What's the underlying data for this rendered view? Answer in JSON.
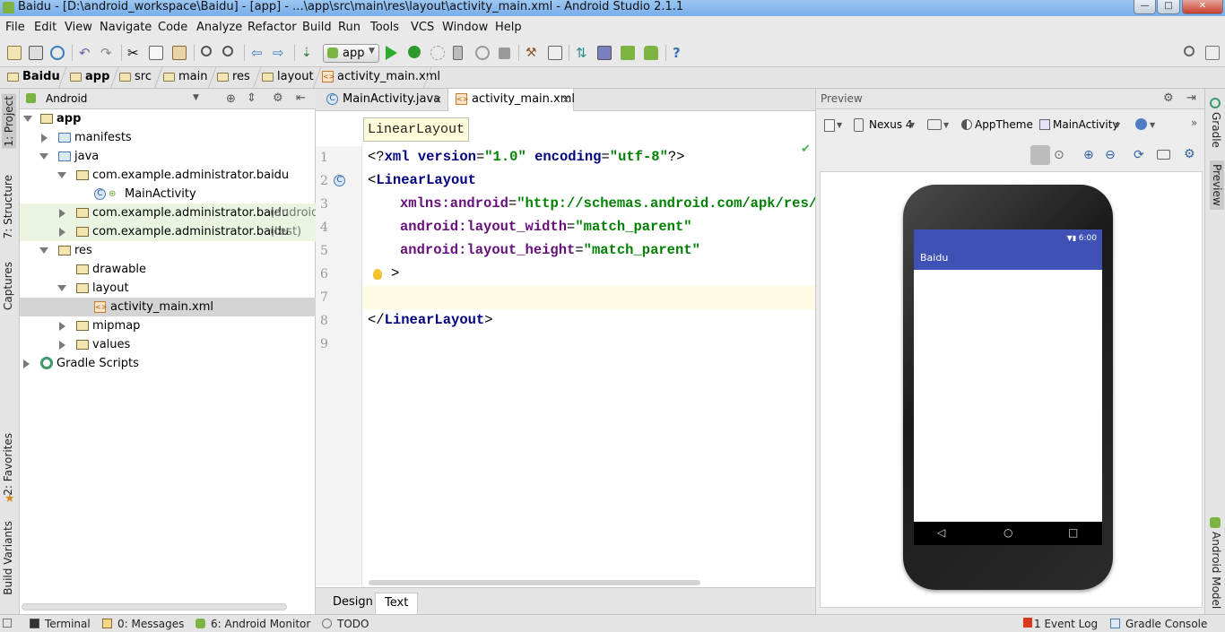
{
  "window": {
    "title": "Baidu - [D:\\android_workspace\\Baidu] - [app] - ...\\app\\src\\main\\res\\layout\\activity_main.xml - Android Studio 2.1.1",
    "minimize": "—",
    "maximize": "□",
    "close": "✕"
  },
  "menu": [
    "File",
    "Edit",
    "View",
    "Navigate",
    "Code",
    "Analyze",
    "Refactor",
    "Build",
    "Run",
    "Tools",
    "VCS",
    "Window",
    "Help"
  ],
  "toolbar": {
    "run_config": "app",
    "help": "?"
  },
  "breadcrumbs": [
    "Baidu",
    "app",
    "src",
    "main",
    "res",
    "layout",
    "activity_main.xml"
  ],
  "left_tool_tabs": [
    "1: Project",
    "7: Structure",
    "Captures",
    "2: Favorites",
    "Build Variants"
  ],
  "right_tool_tabs": [
    "Gradle",
    "Preview",
    "Android Model"
  ],
  "project": {
    "view_mode": "Android",
    "tree": [
      {
        "label": "app",
        "extra": ""
      },
      {
        "label": "manifests",
        "extra": ""
      },
      {
        "label": "java",
        "extra": ""
      },
      {
        "label": "com.example.administrator.baidu",
        "extra": ""
      },
      {
        "label": "MainActivity",
        "extra": ""
      },
      {
        "label": "com.example.administrator.baidu",
        "extra": "(androidTest)"
      },
      {
        "label": "com.example.administrator.baidu",
        "extra": "(test)"
      },
      {
        "label": "res",
        "extra": ""
      },
      {
        "label": "drawable",
        "extra": ""
      },
      {
        "label": "layout",
        "extra": ""
      },
      {
        "label": "activity_main.xml",
        "extra": ""
      },
      {
        "label": "mipmap",
        "extra": ""
      },
      {
        "label": "values",
        "extra": ""
      },
      {
        "label": "Gradle Scripts",
        "extra": ""
      }
    ]
  },
  "editor": {
    "tabs": [
      {
        "label": "MainActivity.java",
        "close": "×"
      },
      {
        "label": "activity_main.xml",
        "close": "×"
      }
    ],
    "tooltip": "LinearLayout",
    "line_numbers": [
      "1",
      "2",
      "3",
      "4",
      "5",
      "6",
      "7",
      "8",
      "9"
    ],
    "code": {
      "l1_a": "<?",
      "l1_b": "xml version",
      "l1_c": "=",
      "l1_d": "\"1.0\"",
      "l1_e": " encoding",
      "l1_f": "=",
      "l1_g": "\"utf-8\"",
      "l1_h": "?>",
      "l2_a": "<",
      "l2_b": "LinearLayout",
      "l3_a": "xmlns:android",
      "l3_b": "=",
      "l3_c": "\"http://schemas.android.com/apk/res/android\"",
      "l4_a": "android:layout_width",
      "l4_b": "=",
      "l4_c": "\"match_parent\"",
      "l5_a": "android:layout_height",
      "l5_b": "=",
      "l5_c": "\"match_parent\"",
      "l6_a": ">",
      "l8_a": "</",
      "l8_b": "LinearLayout",
      "l8_c": ">"
    },
    "bottom_tabs": [
      "Design",
      "Text"
    ]
  },
  "preview": {
    "title": "Preview",
    "device": "Nexus 4",
    "theme": "AppTheme",
    "activity": "MainActivity",
    "phone": {
      "time": "6:00",
      "app_title": "Baidu",
      "back": "◁",
      "home": "○",
      "recents": "□"
    }
  },
  "statusbar": {
    "left": [
      {
        "label": "Terminal"
      },
      {
        "label": "0: Messages"
      },
      {
        "label": "6: Android Monitor"
      },
      {
        "label": "TODO"
      }
    ],
    "right": [
      {
        "label": "Event Log",
        "badge": "1"
      },
      {
        "label": "Gradle Console"
      }
    ]
  },
  "colors": {
    "accent": "#3f51b5",
    "keyword": "#000080",
    "attribute": "#660e7a",
    "string": "#008000",
    "selection": "#d4d4d4"
  }
}
